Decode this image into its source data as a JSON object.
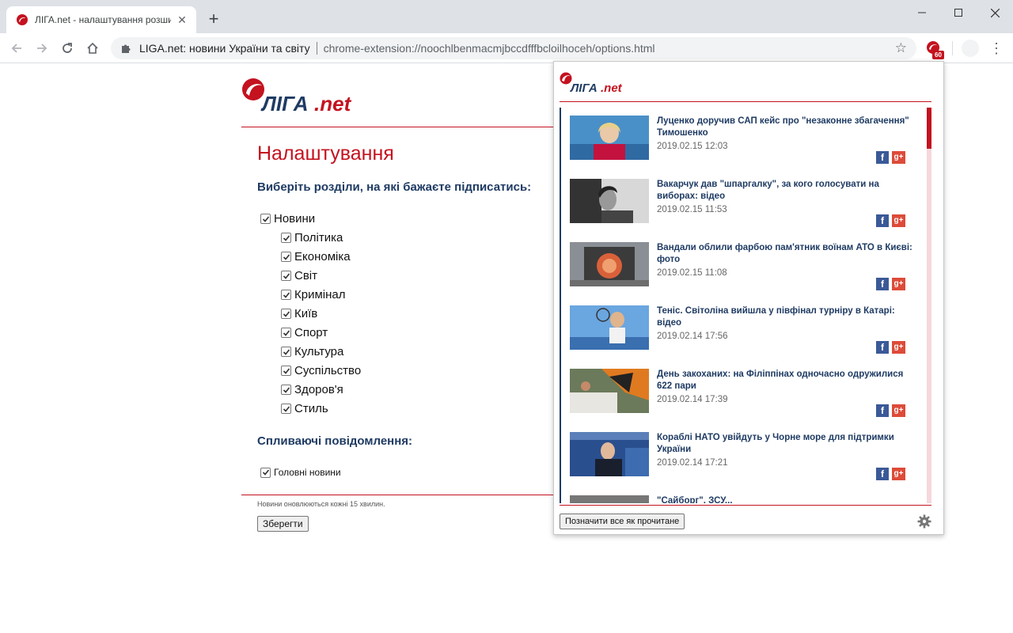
{
  "browser": {
    "tab_title": "ЛІГА.net - налаштування розши",
    "new_tab_label": "+",
    "omnibox_site": "LIGA.net: новини України та світу",
    "omnibox_url": "chrome-extension://noochlbenmacmjbccdfffbcloilhoceh/options.html",
    "extension_badge": "60"
  },
  "options": {
    "title": "Налаштування",
    "sections_heading": "Виберіть розділи, на які бажаєте підписатись:",
    "root_category": {
      "label": "Новини",
      "checked": true
    },
    "categories": [
      {
        "label": "Політика",
        "checked": true
      },
      {
        "label": "Економіка",
        "checked": true
      },
      {
        "label": "Світ",
        "checked": true
      },
      {
        "label": "Кримінал",
        "checked": true
      },
      {
        "label": "Київ",
        "checked": true
      },
      {
        "label": "Спорт",
        "checked": true
      },
      {
        "label": "Культура",
        "checked": true
      },
      {
        "label": "Суспільство",
        "checked": true
      },
      {
        "label": "Здоров'я",
        "checked": true
      },
      {
        "label": "Стиль",
        "checked": true
      }
    ],
    "popup_heading": "Спливаючі повідомлення:",
    "popup_option": {
      "label": "Головні новини",
      "checked": true
    },
    "update_note": "Новини оновлюються кожні 15 хвилин.",
    "save_label": "Зберегти"
  },
  "popup": {
    "news": [
      {
        "title": "Луценко доручив САП кейс про \"незаконне збагачення\" Тимошенко",
        "date": "2019.02.15 12:03"
      },
      {
        "title": "Вакарчук дав \"шпаргалку\", за кого голосувати на виборах: відео",
        "date": "2019.02.15 11:53"
      },
      {
        "title": "Вандали облили фарбою пам'ятник воїнам АТО в Києві: фото",
        "date": "2019.02.15 11:08"
      },
      {
        "title": "Теніс. Світоліна вийшла у півфінал турніру в Катарі: відео",
        "date": "2019.02.14 17:56"
      },
      {
        "title": "День закоханих: на Філіппінах одночасно одружилися 622 пари",
        "date": "2019.02.14 17:39"
      },
      {
        "title": "Кораблі НАТО увійдуть у Чорне море для підтримки України",
        "date": "2019.02.14 17:21"
      },
      {
        "title": "\"Сайборг\". ЗСУ... ",
        "date": ""
      }
    ],
    "facebook_label": "f",
    "gplus_label": "g+",
    "mark_all_read_label": "Позначити все як прочитане"
  },
  "brand": {
    "logo_main": "ЛІГА",
    "logo_suffix": ".net",
    "accent": "#c4121f",
    "navy": "#1f3b63"
  }
}
